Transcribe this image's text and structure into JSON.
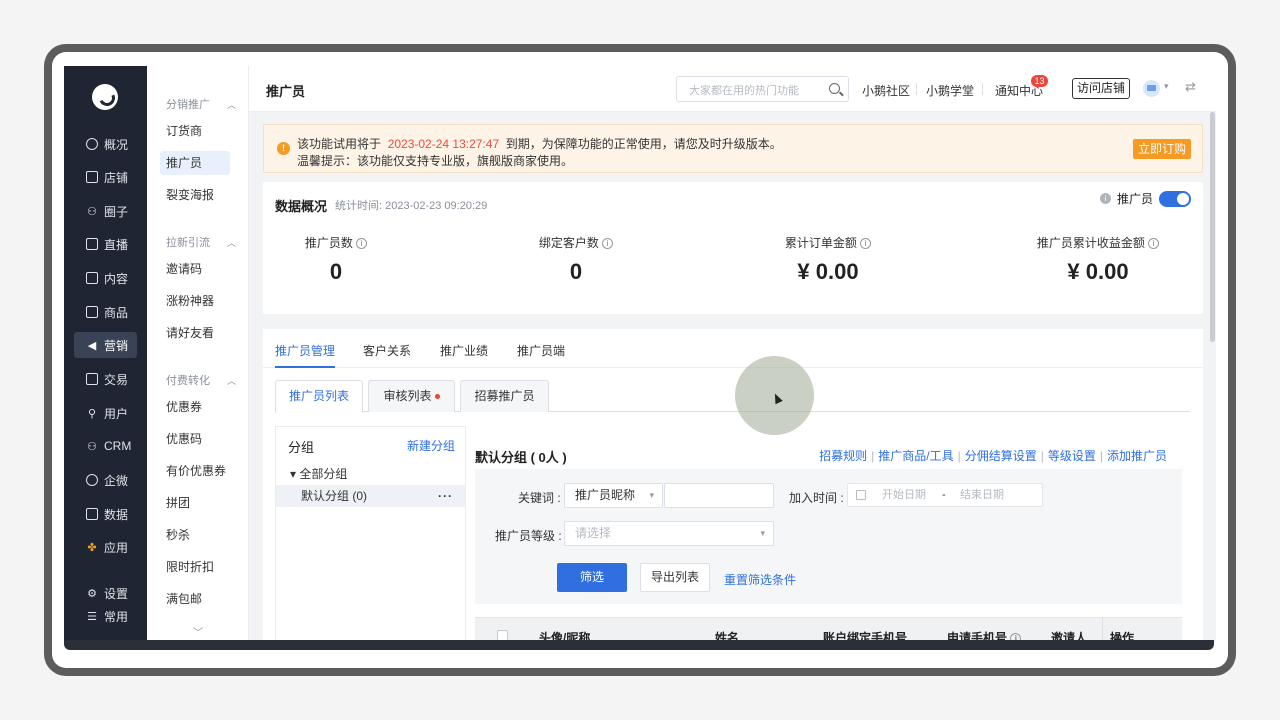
{
  "rail": {
    "items": [
      {
        "label": "概况",
        "icon": "pie-chart-icon"
      },
      {
        "label": "店铺",
        "icon": "store-icon"
      },
      {
        "label": "圈子",
        "icon": "community-icon"
      },
      {
        "label": "直播",
        "icon": "live-icon"
      },
      {
        "label": "内容",
        "icon": "document-icon"
      },
      {
        "label": "商品",
        "icon": "product-icon"
      },
      {
        "label": "营销",
        "icon": "megaphone-icon"
      },
      {
        "label": "交易",
        "icon": "trade-icon"
      },
      {
        "label": "用户",
        "icon": "user-icon"
      },
      {
        "label": "CRM",
        "icon": "crm-icon"
      },
      {
        "label": "企微",
        "icon": "wecom-icon"
      },
      {
        "label": "数据",
        "icon": "data-icon"
      },
      {
        "label": "应用",
        "icon": "apps-icon"
      }
    ],
    "settings": "设置",
    "common": "常用"
  },
  "side": {
    "groups": [
      {
        "label": "分销推广",
        "items": [
          "订货商",
          "推广员",
          "裂变海报"
        ]
      },
      {
        "label": "拉新引流",
        "items": [
          "邀请码",
          "涨粉神器",
          "请好友看"
        ]
      },
      {
        "label": "付费转化",
        "items": [
          "优惠券",
          "优惠码",
          "有价优惠券",
          "拼团",
          "秒杀",
          "限时折扣",
          "满包邮"
        ]
      }
    ],
    "active": "推广员"
  },
  "header": {
    "title": "推广员",
    "search_placeholder": "大家都在用的热门功能",
    "links": [
      "小鹅社区",
      "小鹅学堂",
      "通知中心"
    ],
    "notification_count": "13",
    "visit_store": "访问店铺"
  },
  "notice": {
    "line1_prefix": "该功能试用将于",
    "line1_date": "2023-02-24 13:27:47",
    "line1_suffix": "到期，为保障功能的正常使用，请您及时升级版本。",
    "line2": "温馨提示：该功能仅支持专业版，旗舰版商家使用。",
    "button": "立即订购"
  },
  "overview": {
    "title": "数据概况",
    "time": "统计时间: 2023-02-23 09:20:29",
    "toggle_label": "推广员",
    "stats": [
      {
        "label": "推广员数",
        "value": "0"
      },
      {
        "label": "绑定客户数",
        "value": "0"
      },
      {
        "label": "累计订单金额",
        "value": "¥ 0.00"
      },
      {
        "label": "推广员累计收益金额",
        "value": "¥ 0.00"
      }
    ]
  },
  "tabs": [
    "推广员管理",
    "客户关系",
    "推广业绩",
    "推广员端"
  ],
  "subtabs": [
    "推广员列表",
    "审核列表",
    "招募推广员"
  ],
  "groups_pane": {
    "title": "分组",
    "new_group": "新建分组",
    "all": "▾ 全部分组",
    "default": "默认分组 (0)"
  },
  "list": {
    "title": "默认分组 ( 0人 )",
    "links": [
      "招募规则",
      "推广商品/工具",
      "分佣结算设置",
      "等级设置",
      "添加推广员"
    ]
  },
  "filter": {
    "keyword_label": "关键词 :",
    "keyword_select": "推广员昵称",
    "join_time_label": "加入时间 :",
    "start_placeholder": "开始日期",
    "date_sep": "-",
    "end_placeholder": "结束日期",
    "level_label": "推广员等级 :",
    "level_placeholder": "请选择",
    "filter_button": "筛选",
    "export_button": "导出列表",
    "reset_link": "重置筛选条件"
  },
  "table": {
    "columns": [
      "头像/昵称",
      "姓名",
      "账户绑定手机号",
      "申请手机号",
      "邀请人",
      "操作"
    ]
  }
}
